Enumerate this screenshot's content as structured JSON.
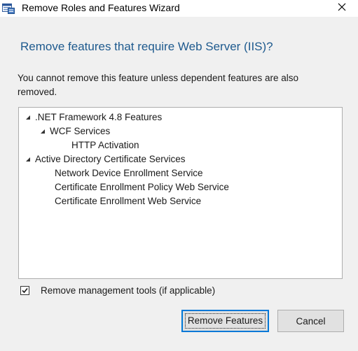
{
  "window": {
    "title": "Remove Roles and Features Wizard",
    "icons": {
      "app": "server-manager-icon",
      "close": "close-icon"
    }
  },
  "dialog": {
    "heading": "Remove features that require Web Server (IIS)?",
    "description": "You cannot remove this feature unless dependent features are also removed."
  },
  "tree": {
    "items": [
      {
        "label": ".NET Framework 4.8 Features",
        "expanded": true,
        "expander": "collapse-arrow-icon"
      },
      {
        "label": "WCF Services",
        "expanded": true,
        "expander": "collapse-arrow-icon"
      },
      {
        "label": "HTTP Activation"
      },
      {
        "label": "Active Directory Certificate Services",
        "expanded": true,
        "expander": "collapse-arrow-icon"
      },
      {
        "label": "Network Device Enrollment Service"
      },
      {
        "label": "Certificate Enrollment Policy Web Service"
      },
      {
        "label": "Certificate Enrollment Web Service"
      }
    ]
  },
  "options": {
    "remove_management_tools": {
      "label": "Remove management tools (if applicable)",
      "checked": true
    }
  },
  "buttons": {
    "remove_features": "Remove Features",
    "cancel": "Cancel"
  },
  "colors": {
    "heading": "#1e5a8e",
    "content_background": "#f0f0f0",
    "button_focus_border": "#0078d7"
  }
}
